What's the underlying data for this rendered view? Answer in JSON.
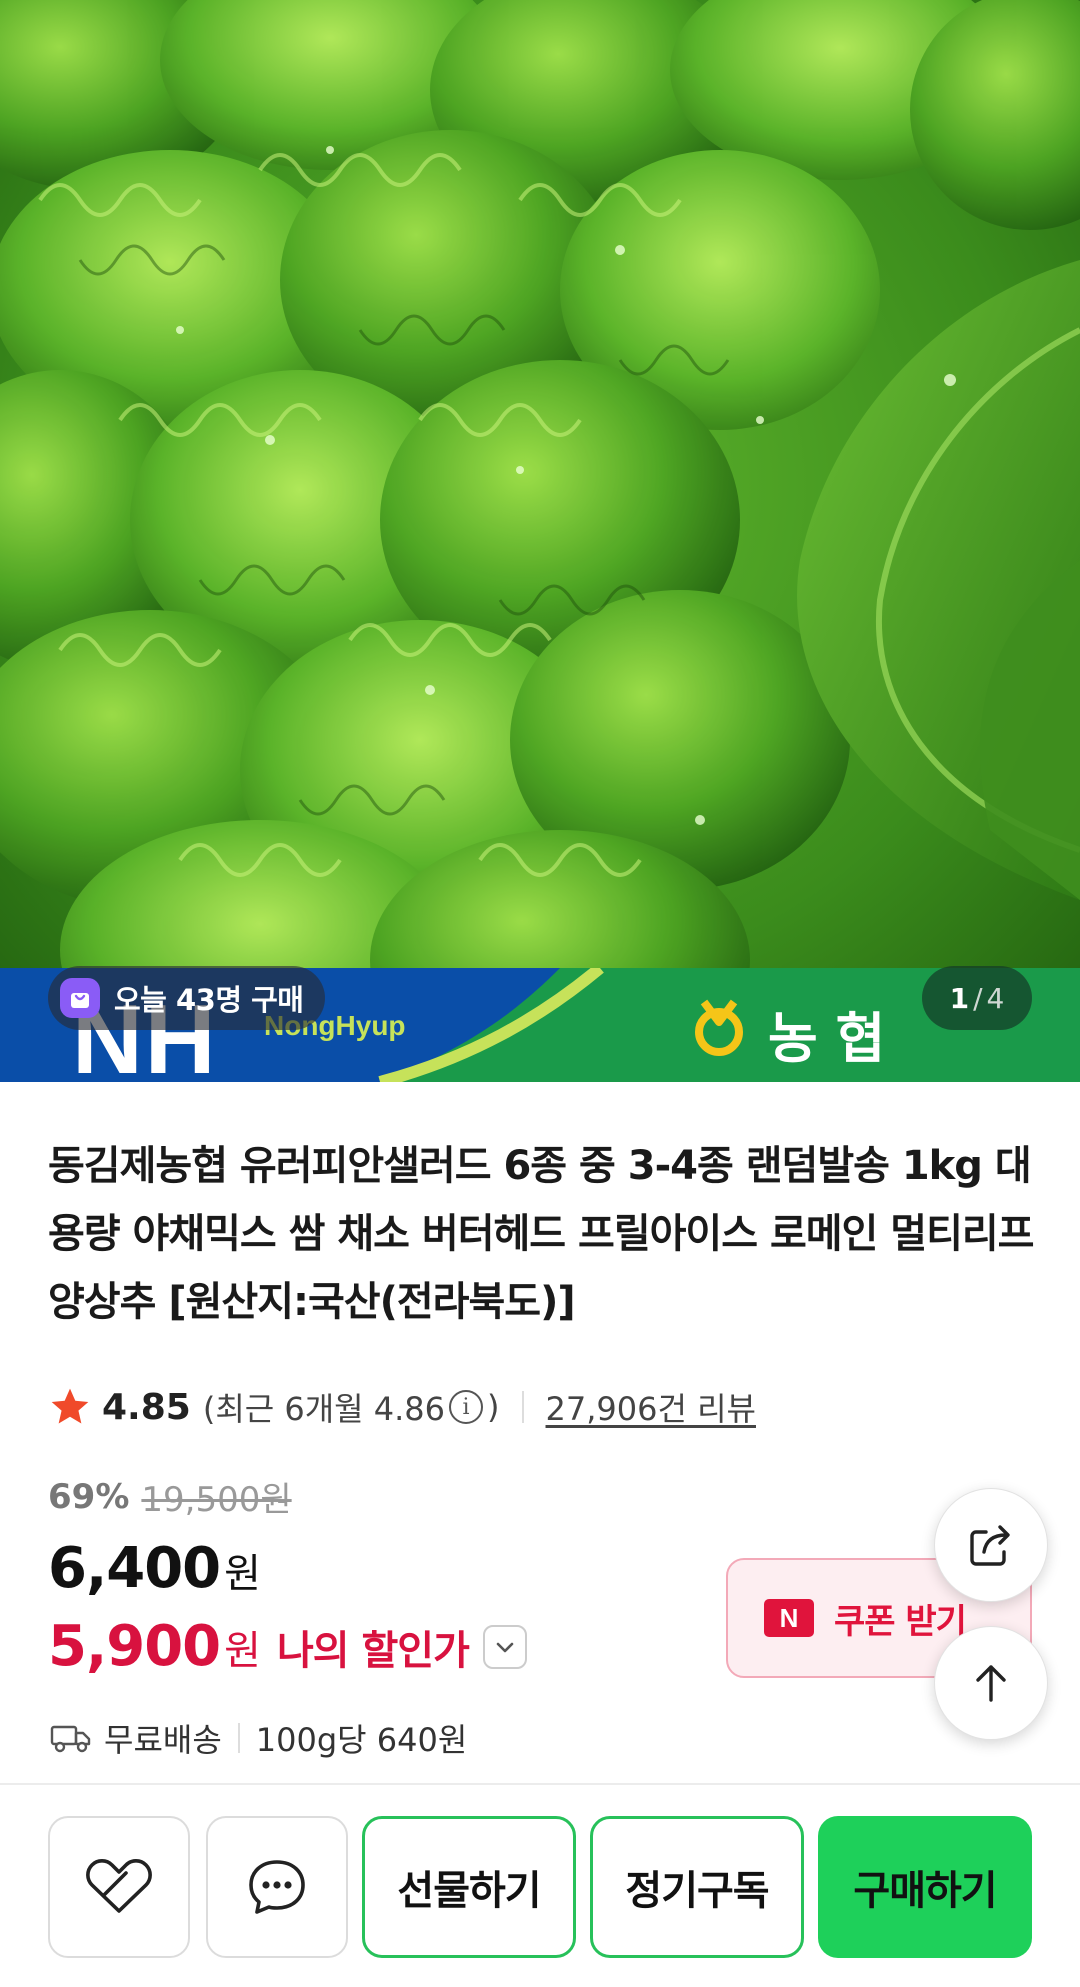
{
  "hero": {
    "image_alt": "lettuce",
    "banner": {
      "brand_letters": "NH",
      "brand_sub": "NongHyup",
      "brand_korean": "농협"
    },
    "buyers_today": "오늘 43명 구매",
    "counter": {
      "current": "1",
      "separator": "/",
      "total": "4"
    }
  },
  "product": {
    "title": "동김제농협 유러피안샐러드 6종 중 3-4종 랜덤발송 1kg 대용량 야채믹스 쌈 채소 버터헤드 프릴아이스 로메인 멀티리프 양상추 [원산지:국산(전라북도)]",
    "rating": {
      "value": "4.85",
      "recent_prefix": "(최근 6개월 4.86",
      "recent_suffix": ")",
      "review_count": "27,906건 리뷰"
    },
    "price": {
      "discount_pct": "69%",
      "original": "19,500원",
      "sale_amount": "6,400",
      "sale_unit": "원",
      "my_amount": "5,900",
      "my_unit": "원",
      "my_label": "나의 할인가"
    },
    "shipping": {
      "free": "무료배송",
      "unit_price": "100g당 640원"
    },
    "coupon": {
      "badge": "N",
      "label": "쿠폰 받기"
    }
  },
  "bottom_bar": {
    "gift": "선물하기",
    "subscribe": "정기구독",
    "buy": "구매하기"
  },
  "colors": {
    "accent_green": "#1ed05a",
    "sale_red": "#d8123f",
    "coupon_red": "#e0143c"
  },
  "icons": [
    "bag-icon",
    "star-icon",
    "info-icon",
    "truck-icon",
    "npay-icon",
    "share-icon",
    "arrow-up-icon",
    "heart-icon",
    "chat-icon",
    "chevron-down-icon"
  ]
}
